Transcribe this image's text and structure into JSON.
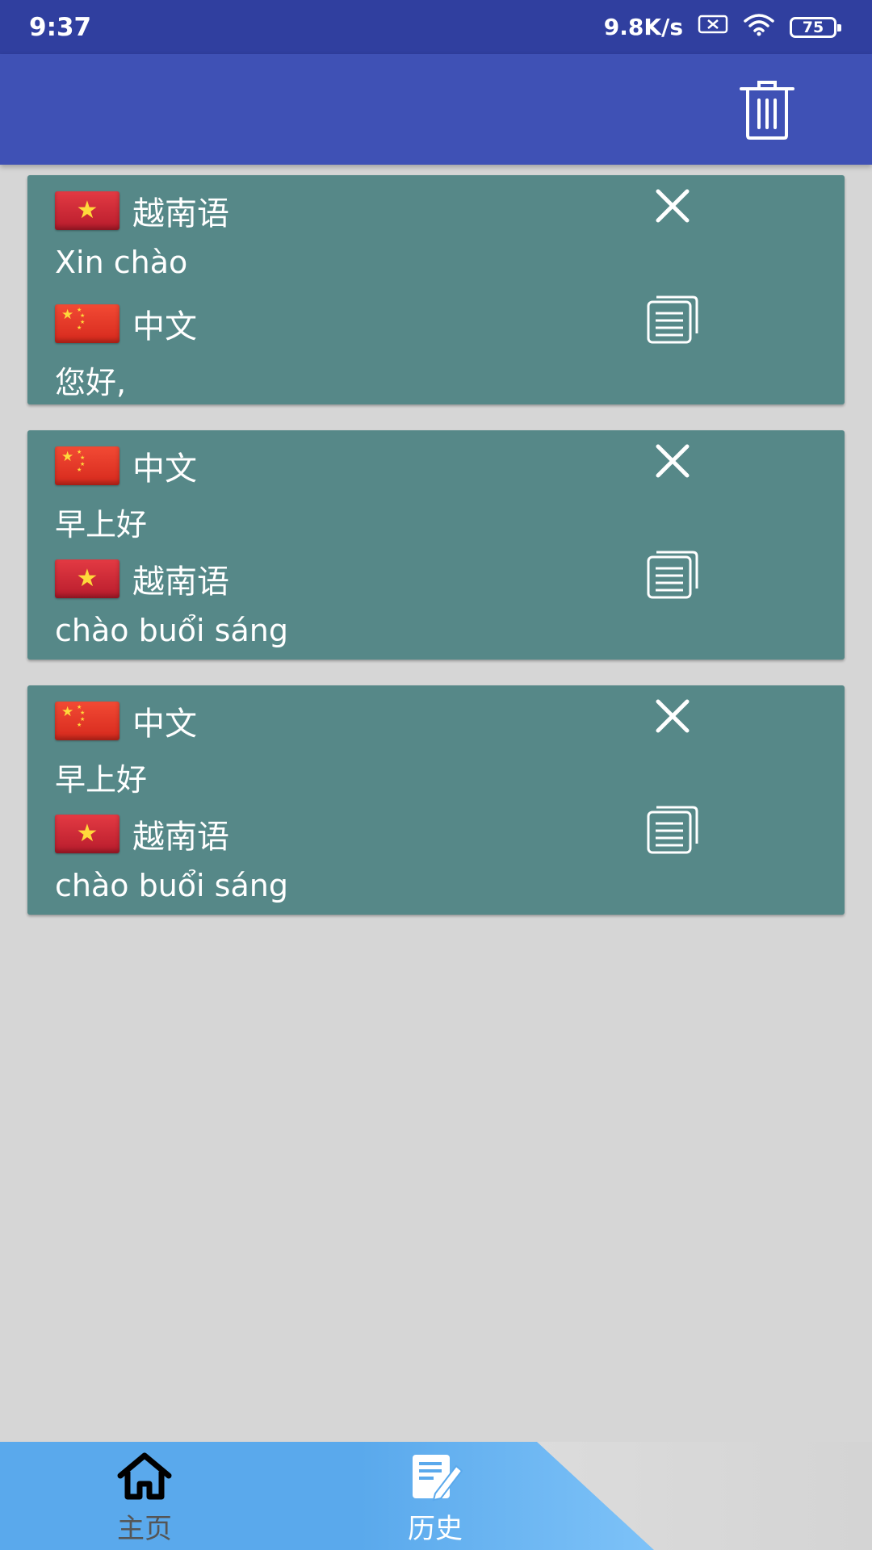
{
  "status_bar": {
    "time": "9:37",
    "network_speed": "9.8K/s",
    "battery": "75"
  },
  "toolbar": {
    "delete_all_icon": "trash-icon"
  },
  "history": [
    {
      "source_lang": "越南语",
      "source_flag": "vn",
      "source_text": "Xin chào",
      "target_lang": "中文",
      "target_flag": "cn",
      "target_text": "您好,"
    },
    {
      "source_lang": "中文",
      "source_flag": "cn",
      "source_text": "早上好",
      "target_lang": "越南语",
      "target_flag": "vn",
      "target_text": "chào buổi sáng"
    },
    {
      "source_lang": "中文",
      "source_flag": "cn",
      "source_text": "早上好",
      "target_lang": "越南语",
      "target_flag": "vn",
      "target_text": "chào buổi sáng"
    }
  ],
  "bottom_nav": {
    "home": "主页",
    "history": "历史",
    "active": "history"
  },
  "colors": {
    "status_bar": "#303f9f",
    "app_bar": "#3f51b5",
    "card": "#568888",
    "nav": "#5aa9ec"
  }
}
